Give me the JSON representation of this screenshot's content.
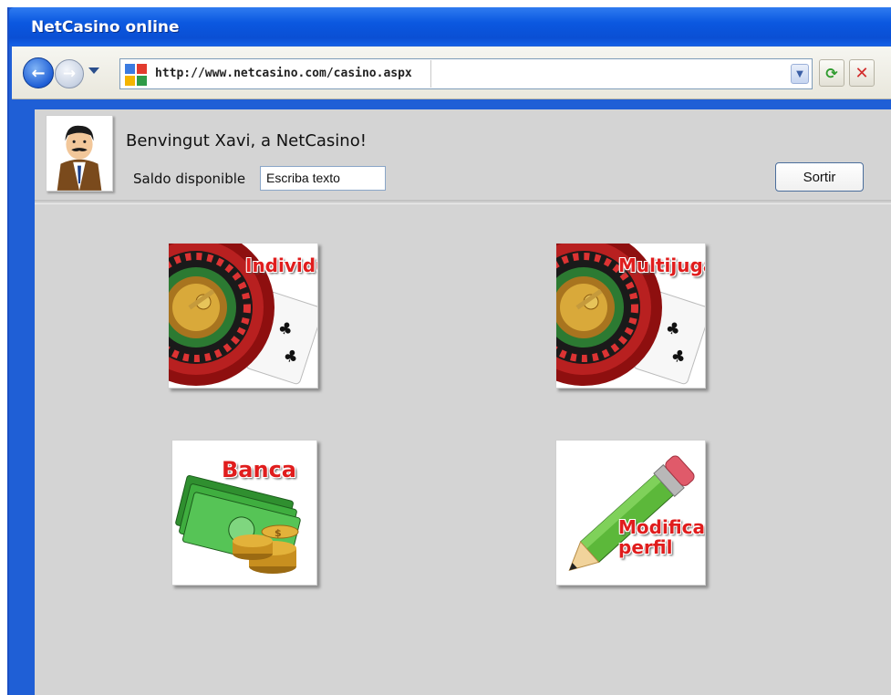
{
  "window": {
    "title": "NetCasino online"
  },
  "browser": {
    "url": "http://www.netcasino.com/casino.aspx"
  },
  "header": {
    "welcome": "Benvingut Xavi, a NetCasino!",
    "balance_label": "Saldo disponible",
    "balance_placeholder": "Escriba texto",
    "logout_label": "Sortir"
  },
  "tiles": [
    {
      "label": "Individual",
      "icon": "roulette-cards-icon"
    },
    {
      "label": "Multijugador",
      "icon": "roulette-cards-icon"
    },
    {
      "label": "Banca",
      "icon": "money-coins-icon"
    },
    {
      "label_lines": [
        "Modificar",
        "perfil"
      ],
      "icon": "pencil-icon"
    }
  ],
  "colors": {
    "title_bar": "#0a4fd4",
    "content_bg": "#d4d4d4",
    "tile_label": "#e01d1d"
  }
}
